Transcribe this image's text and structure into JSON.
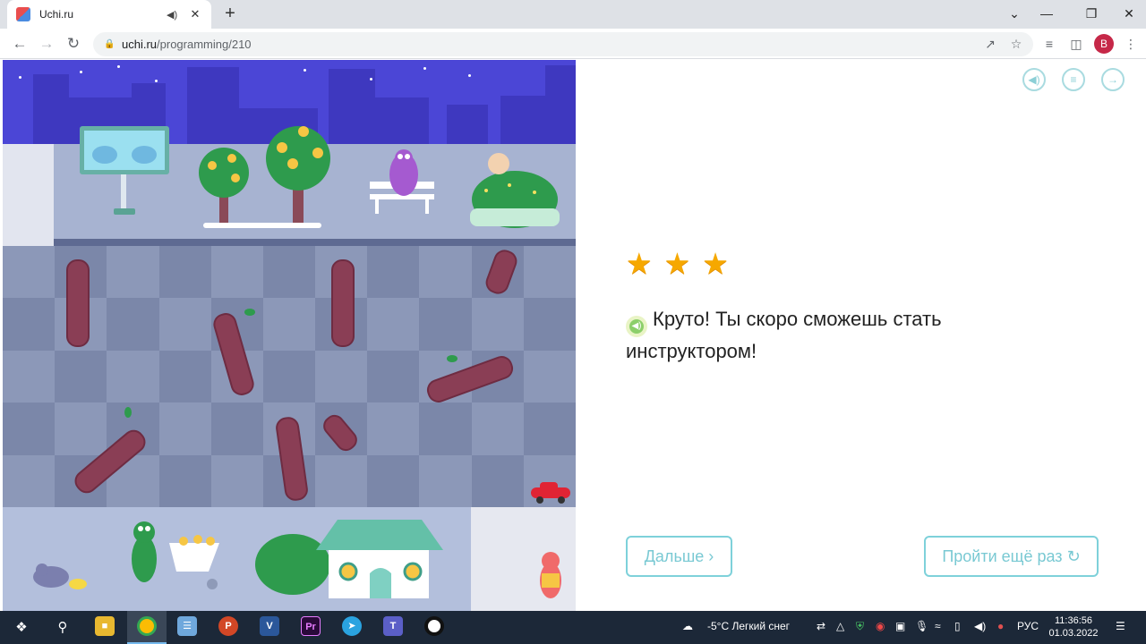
{
  "browser": {
    "tab_title": "Uchi.ru",
    "new_tab_symbol": "+",
    "url_host": "uchi.ru",
    "url_path": "/programming/210",
    "profile_initial": "B"
  },
  "panel": {
    "stars_count": 3,
    "message": "Круто! Ты скоро сможешь стать инструктором!",
    "next_button": "Дальше ›",
    "retry_button": "Пройти ещё раз ↻"
  },
  "taskbar": {
    "weather": "-5°C  Легкий снег",
    "language": "РУС",
    "time": "11:36:56",
    "date": "01.03.2022"
  },
  "colors": {
    "accent": "#7ed1da",
    "star": "#f6a800",
    "sky": "#4b46d6",
    "log": "#8a3e55"
  }
}
